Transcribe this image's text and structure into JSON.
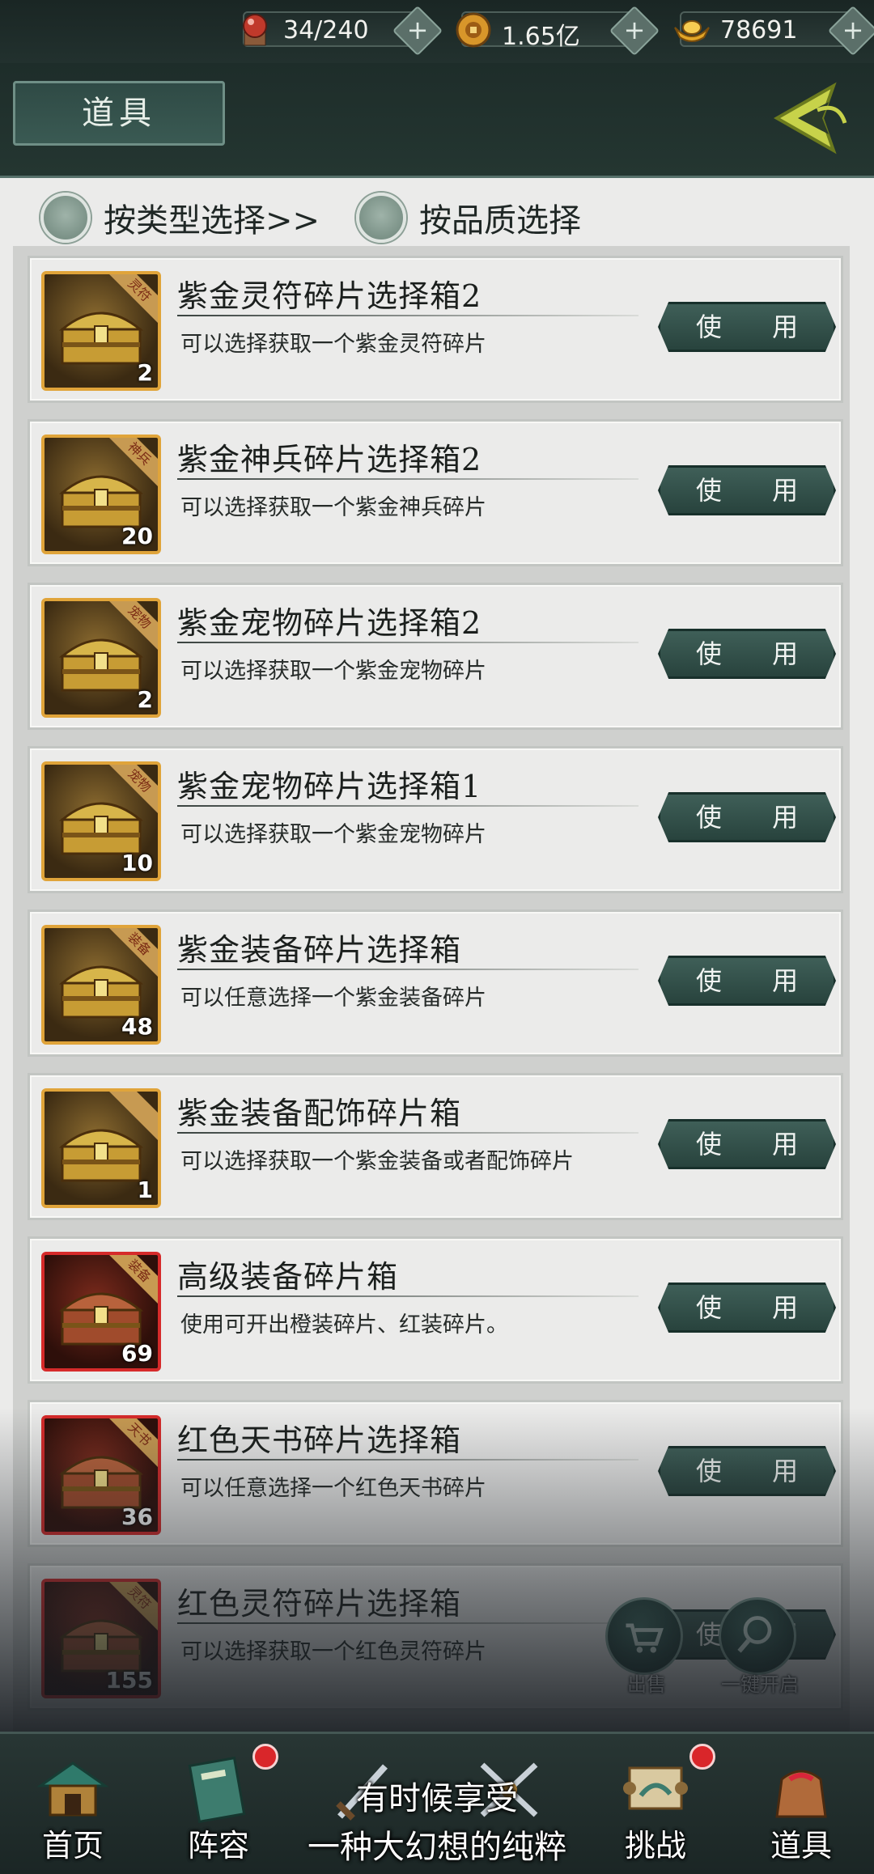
{
  "resources": [
    {
      "icon": "energy-orb-icon",
      "value": "34/240"
    },
    {
      "icon": "coin-icon",
      "value": "1.65亿"
    },
    {
      "icon": "gold-ingot-icon",
      "value": "78691"
    }
  ],
  "header": {
    "title": "道具"
  },
  "filters": [
    {
      "label": "按类型选择>>"
    },
    {
      "label": "按品质选择"
    }
  ],
  "use_label": "使 用",
  "items": [
    {
      "name": "紫金灵符碎片选择箱2",
      "desc": "可以选择获取一个紫金灵符碎片",
      "count": "2",
      "tag": "灵符",
      "frame": "gold"
    },
    {
      "name": "紫金神兵碎片选择箱2",
      "desc": "可以选择获取一个紫金神兵碎片",
      "count": "20",
      "tag": "神兵",
      "frame": "gold"
    },
    {
      "name": "紫金宠物碎片选择箱2",
      "desc": "可以选择获取一个紫金宠物碎片",
      "count": "2",
      "tag": "宠物",
      "frame": "gold"
    },
    {
      "name": "紫金宠物碎片选择箱1",
      "desc": "可以选择获取一个紫金宠物碎片",
      "count": "10",
      "tag": "宠物",
      "frame": "gold"
    },
    {
      "name": "紫金装备碎片选择箱",
      "desc": "可以任意选择一个紫金装备碎片",
      "count": "48",
      "tag": "装备",
      "frame": "gold"
    },
    {
      "name": "紫金装备配饰碎片箱",
      "desc": "可以选择获取一个紫金装备或者配饰碎片",
      "count": "1",
      "tag": "",
      "frame": "gold"
    },
    {
      "name": "高级装备碎片箱",
      "desc": "使用可开出橙装碎片、红装碎片。",
      "count": "69",
      "tag": "装备",
      "frame": "red"
    },
    {
      "name": "红色天书碎片选择箱",
      "desc": "可以任意选择一个红色天书碎片",
      "count": "36",
      "tag": "天书",
      "frame": "red"
    },
    {
      "name": "红色灵符碎片选择箱",
      "desc": "可以选择获取一个红色灵符碎片",
      "count": "155",
      "tag": "灵符",
      "frame": "red"
    }
  ],
  "floating": {
    "sell": "出售",
    "open_all": "一键开启"
  },
  "nav": [
    {
      "label": "首页",
      "icon": "home-pavilion-icon",
      "badge": false
    },
    {
      "label": "阵容",
      "icon": "lineup-book-icon",
      "badge": true
    },
    {
      "label": "",
      "icon": "sword-icon",
      "badge": false
    },
    {
      "label": "",
      "icon": "crossed-swords-icon",
      "badge": false
    },
    {
      "label": "挑战",
      "icon": "challenge-scroll-icon",
      "badge": true
    },
    {
      "label": "道具",
      "icon": "item-bag-icon",
      "badge": false
    }
  ],
  "subtitles": {
    "line1": "有时候享受",
    "line2": "一种大幻想的纯粹"
  },
  "colors": {
    "accent": "#2f4a45",
    "gold_frame": "#e0a43a",
    "red_frame": "#d62a2a",
    "badge": "#d9262a"
  }
}
